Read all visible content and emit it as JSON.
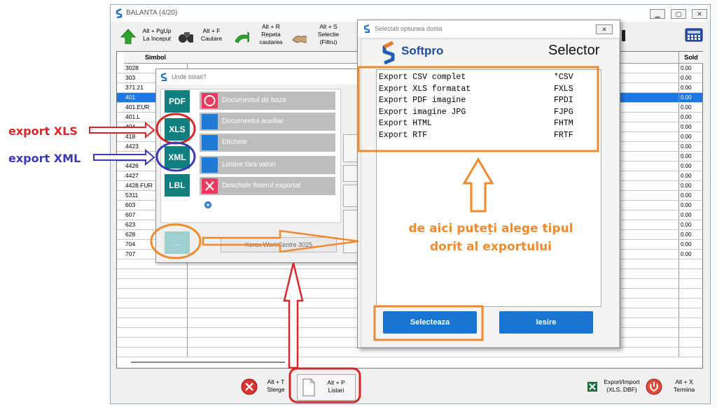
{
  "main": {
    "title": "BALANTA  (4/20)",
    "toolbar": [
      {
        "shortcut": "Alt + PgUp",
        "label": "La început"
      },
      {
        "shortcut": "Alt + F",
        "label": "Cautare"
      },
      {
        "shortcut": "Alt + R",
        "label": "Repeta cautarea"
      },
      {
        "shortcut": "Alt + S",
        "label": "Selectie (Filtru)"
      }
    ],
    "grid": {
      "col_symbol": "Simbol",
      "col_sold": "Sold",
      "rows": [
        {
          "sym": "3028",
          "sold": "0.00"
        },
        {
          "sym": "303",
          "sold": "0.00"
        },
        {
          "sym": "371.21",
          "sold": "0.00"
        },
        {
          "sym": "401",
          "sold": "0.00"
        },
        {
          "sym": "401.EUR",
          "sold": "0.00"
        },
        {
          "sym": "401.L",
          "sold": "0.00"
        },
        {
          "sym": "404",
          "sold": "0.00"
        },
        {
          "sym": "418",
          "sold": "0.00"
        },
        {
          "sym": "4423",
          "sold": "0.00"
        },
        {
          "sym": "4424",
          "sold": "0.00"
        },
        {
          "sym": "4426",
          "sold": "0.00"
        },
        {
          "sym": "4427",
          "sold": "0.00"
        },
        {
          "sym": "4428.FUR",
          "sold": "0.00"
        },
        {
          "sym": "5311",
          "sold": "0.00"
        },
        {
          "sym": "603",
          "sold": "0.00"
        },
        {
          "sym": "607",
          "sold": "0.00"
        },
        {
          "sym": "623",
          "sold": "0.00"
        },
        {
          "sym": "628",
          "sold": "0.00"
        },
        {
          "sym": "704",
          "sold": "0.00"
        },
        {
          "sym": "707",
          "sold": "0.00"
        }
      ]
    },
    "bottom": {
      "delete_shortcut": "Alt + T",
      "delete_label": "Sterge",
      "print_shortcut": "Alt + P",
      "print_label": "Listari",
      "export_label": "Export/Import",
      "export_sub": "(XLS, DBF)",
      "exit_shortcut": "Alt + X",
      "exit_label": "Termina"
    }
  },
  "unde": {
    "title": "Unde listati?",
    "formats": [
      "PDF",
      "XLS",
      "XML",
      "LBL",
      "..."
    ],
    "options": [
      "Documentul de baza",
      "Documentul auxiliar",
      "Etichete",
      "Listare fara valori",
      "Deschide fisierul exportat"
    ],
    "printer": "Xerox WorkCentre 3025"
  },
  "selector": {
    "title": "Selectati optiunea dorita",
    "brand": "Softpro",
    "heading": "Selector",
    "items": [
      {
        "name": "Export CSV complet",
        "code": "*CSV"
      },
      {
        "name": "Export XLS formatat",
        "code": "FXLS"
      },
      {
        "name": "Export PDF imagine",
        "code": "FPDI"
      },
      {
        "name": "Export imagine JPG",
        "code": "FJPG"
      },
      {
        "name": "Export HTML",
        "code": "FHTM"
      },
      {
        "name": "Export RTF",
        "code": "FRTF"
      }
    ],
    "select_label": "Selecteaza",
    "exit_label": "Iesire"
  },
  "annotations": {
    "xls": "export XLS",
    "xml": "export XML",
    "hint_line1": "de aici puteți alege tipul",
    "hint_line2": "dorit al exportului"
  },
  "colors": {
    "accent_blue": "#1876d2",
    "teal": "#0f7f7f",
    "annot_red": "#d62828",
    "annot_blue": "#3a3ab8",
    "annot_orange": "#f08a2c"
  }
}
